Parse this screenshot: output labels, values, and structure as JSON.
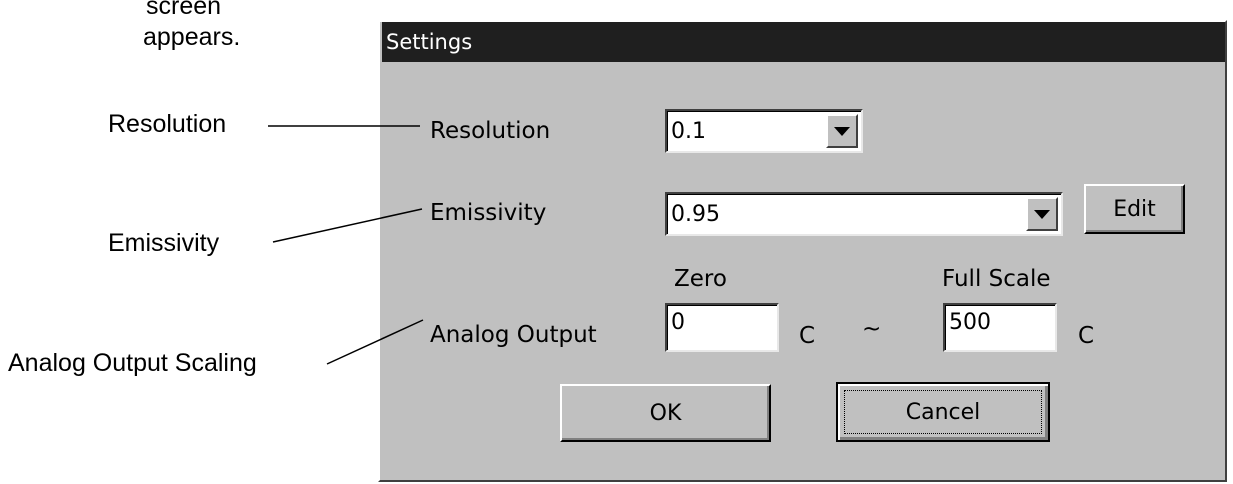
{
  "intro": {
    "line1": "screen",
    "line2": "appears."
  },
  "callouts": {
    "resolution": "Resolution",
    "emissivity": "Emissivity",
    "analog_output_scaling": "Analog Output Scaling"
  },
  "dialog": {
    "title": "Settings",
    "resolution": {
      "label": "Resolution",
      "value": "0.1"
    },
    "emissivity": {
      "label": "Emissivity",
      "value": "0.95",
      "edit_label": "Edit"
    },
    "analog_output": {
      "label": "Analog Output",
      "zero_header": "Zero",
      "full_scale_header": "Full Scale",
      "zero_value": "0",
      "zero_unit": "C",
      "separator": "~",
      "full_scale_value": "500",
      "full_scale_unit": "C"
    },
    "ok_label": "OK",
    "cancel_label": "Cancel"
  },
  "colors": {
    "dialog_face": "#c0c0c0",
    "titlebar": "#1f1f1f",
    "field_background": "#ffffff"
  },
  "icons": {
    "dropdown": "chevron-down-icon"
  }
}
